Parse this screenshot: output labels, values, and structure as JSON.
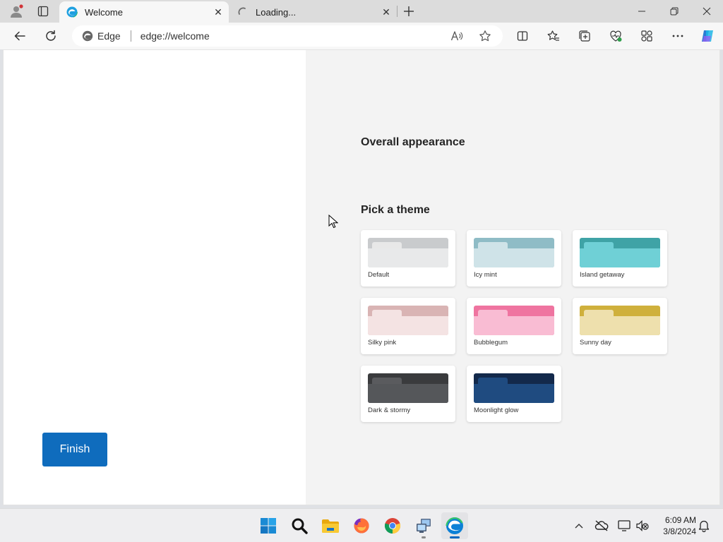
{
  "browser": {
    "tabs": [
      {
        "title": "Welcome",
        "state": "active",
        "icon": "edge-icon"
      },
      {
        "title": "Loading...",
        "state": "loading",
        "icon": "spinner-icon"
      }
    ],
    "address_bar": {
      "identity_label": "Edge",
      "url": "edge://welcome"
    }
  },
  "page": {
    "finish_label": "Finish",
    "overall_appearance_heading": "Overall appearance",
    "pick_theme_heading": "Pick a theme",
    "themes": [
      {
        "name": "Default",
        "frame_color": "#c9cbcd",
        "tab_color": "#e8e8e8",
        "body_color": "#e8e9ea"
      },
      {
        "name": "Icy mint",
        "frame_color": "#8fbcc6",
        "tab_color": "#cfe3e8",
        "body_color": "#cfe3e8"
      },
      {
        "name": "Island getaway",
        "frame_color": "#3fa3a6",
        "tab_color": "#6fd0d6",
        "body_color": "#6fd0d6"
      },
      {
        "name": "Silky pink",
        "frame_color": "#d9b4b4",
        "tab_color": "#f4e3e3",
        "body_color": "#f4e3e3"
      },
      {
        "name": "Bubblegum",
        "frame_color": "#ef74a0",
        "tab_color": "#f9bcd3",
        "body_color": "#f9bcd3"
      },
      {
        "name": "Sunny day",
        "frame_color": "#cfb03c",
        "tab_color": "#eee0ad",
        "body_color": "#eee0ad"
      },
      {
        "name": "Dark & stormy",
        "frame_color": "#3a3b3d",
        "tab_color": "#5a5b5e",
        "body_color": "#55575a"
      },
      {
        "name": "Moonlight glow",
        "frame_color": "#13294b",
        "tab_color": "#1f4b80",
        "body_color": "#1f4b80"
      }
    ]
  },
  "taskbar": {
    "apps": [
      "windows-start",
      "search",
      "file-explorer",
      "firefox",
      "chrome",
      "network-app",
      "edge"
    ],
    "clock_time": "6:09 AM",
    "clock_date": "3/8/2024"
  },
  "colors": {
    "accent": "#0f6cbd",
    "pane_background": "#f3f3f3"
  }
}
